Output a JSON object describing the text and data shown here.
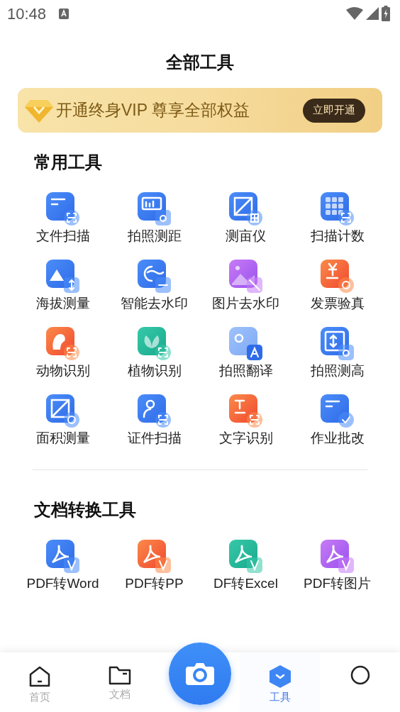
{
  "status_bar": {
    "time": "10:48"
  },
  "title": "全部工具",
  "banner": {
    "text": "开通终身VIP 尊享全部权益",
    "button": "立即开通"
  },
  "sections": [
    {
      "title": "常用工具",
      "tools": [
        "文件扫描",
        "拍照测距",
        "测亩仪",
        "扫描计数",
        "海拔测量",
        "智能去水印",
        "图片去水印",
        "发票验真",
        "动物识别",
        "植物识别",
        "拍照翻译",
        "拍照测高",
        "面积测量",
        "证件扫描",
        "文字识别",
        "作业批改"
      ]
    },
    {
      "title": "文档转换工具",
      "tools": [
        "PDF转Word",
        "PDF转PP",
        "DF转Excel",
        "PDF转图片"
      ]
    }
  ],
  "bottom_nav": [
    {
      "kind": "home",
      "label": "首页",
      "selected": false
    },
    {
      "kind": "folder",
      "label": "文档",
      "selected": false
    },
    {
      "kind": "camera",
      "selected": false
    },
    {
      "kind": "tools",
      "label": "工具",
      "selected": true
    },
    {
      "kind": "profile",
      "selected": false
    }
  ]
}
